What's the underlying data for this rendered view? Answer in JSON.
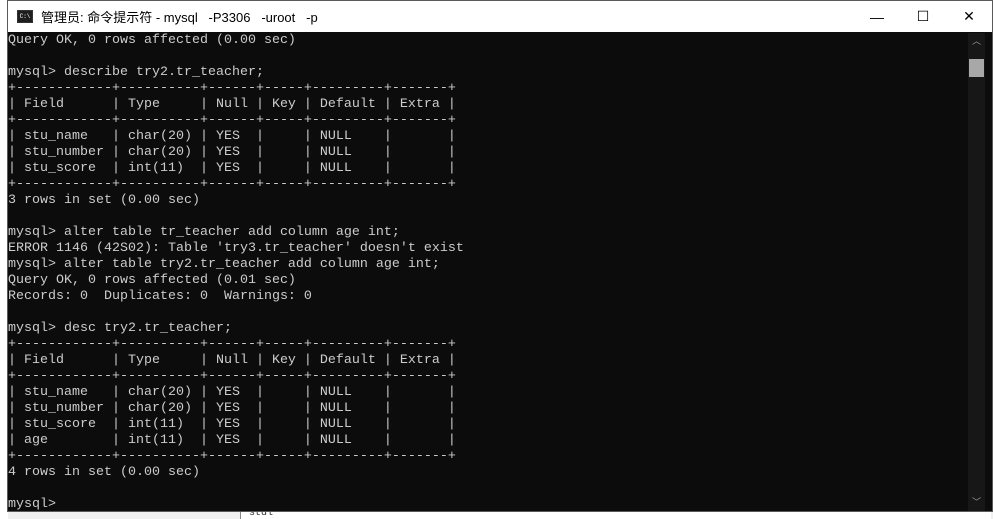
{
  "window": {
    "title": "管理员: 命令提示符 - mysql   -P3306   -uroot   -p",
    "icon": "cmd-icon"
  },
  "controls": {
    "minimize": "—",
    "maximize": "☐",
    "close": "✕"
  },
  "console_lines": [
    "Query OK, 0 rows affected (0.00 sec)",
    "",
    "mysql> describe try2.tr_teacher;",
    "+------------+----------+------+-----+---------+-------+",
    "| Field      | Type     | Null | Key | Default | Extra |",
    "+------------+----------+------+-----+---------+-------+",
    "| stu_name   | char(20) | YES  |     | NULL    |       |",
    "| stu_number | char(20) | YES  |     | NULL    |       |",
    "| stu_score  | int(11)  | YES  |     | NULL    |       |",
    "+------------+----------+------+-----+---------+-------+",
    "3 rows in set (0.00 sec)",
    "",
    "mysql> alter table tr_teacher add column age int;",
    "ERROR 1146 (42S02): Table 'try3.tr_teacher' doesn't exist",
    "mysql> alter table try2.tr_teacher add column age int;",
    "Query OK, 0 rows affected (0.01 sec)",
    "Records: 0  Duplicates: 0  Warnings: 0",
    "",
    "mysql> desc try2.tr_teacher;",
    "+------------+----------+------+-----+---------+-------+",
    "| Field      | Type     | Null | Key | Default | Extra |",
    "+------------+----------+------+-----+---------+-------+",
    "| stu_name   | char(20) | YES  |     | NULL    |       |",
    "| stu_number | char(20) | YES  |     | NULL    |       |",
    "| stu_score  | int(11)  | YES  |     | NULL    |       |",
    "| age        | int(11)  | YES  |     | NULL    |       |",
    "+------------+----------+------+-----+---------+-------+",
    "4 rows in set (0.00 sec)",
    "",
    "mysql>"
  ],
  "background": {
    "peek_text": "stdl"
  }
}
